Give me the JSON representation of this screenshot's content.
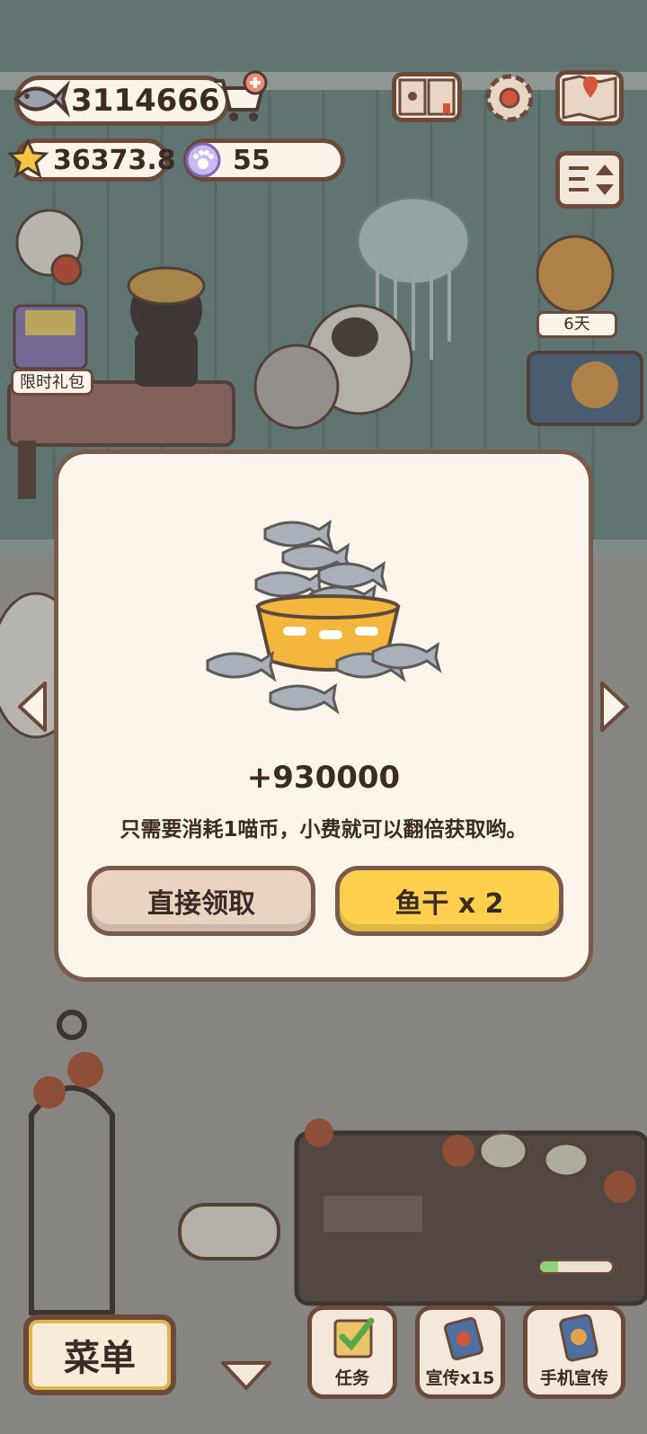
{
  "hud": {
    "fish_count": "3114666",
    "star_count": "36373.8",
    "paw_coin_count": "55",
    "icons": [
      "fish-icon",
      "cart-add-icon",
      "star-icon",
      "paw-coin-icon",
      "book-icon",
      "gear-icon",
      "map-icon",
      "sort-icon"
    ]
  },
  "scene": {
    "gift_pack_label": "限时礼包",
    "event_days_label": "6天"
  },
  "dialog": {
    "reward_text": "+930000",
    "message": "只需要消耗1喵币，小费就可以翻倍获取哟。",
    "claim_button": "直接领取",
    "double_button": "鱼干 x 2",
    "image": "fish-bowl-icon"
  },
  "bottom_bar": {
    "menu_label": "菜单",
    "task_label": "任务",
    "promo_label": "宣传x15",
    "phone_promo_label": "手机宣传",
    "phone_promo_progress": 0.25
  },
  "colors": {
    "panel": "#fbf5ec",
    "outline": "#7a5a4a",
    "primary_button": "#ffd04e",
    "secondary_button": "#ebd3c1"
  }
}
